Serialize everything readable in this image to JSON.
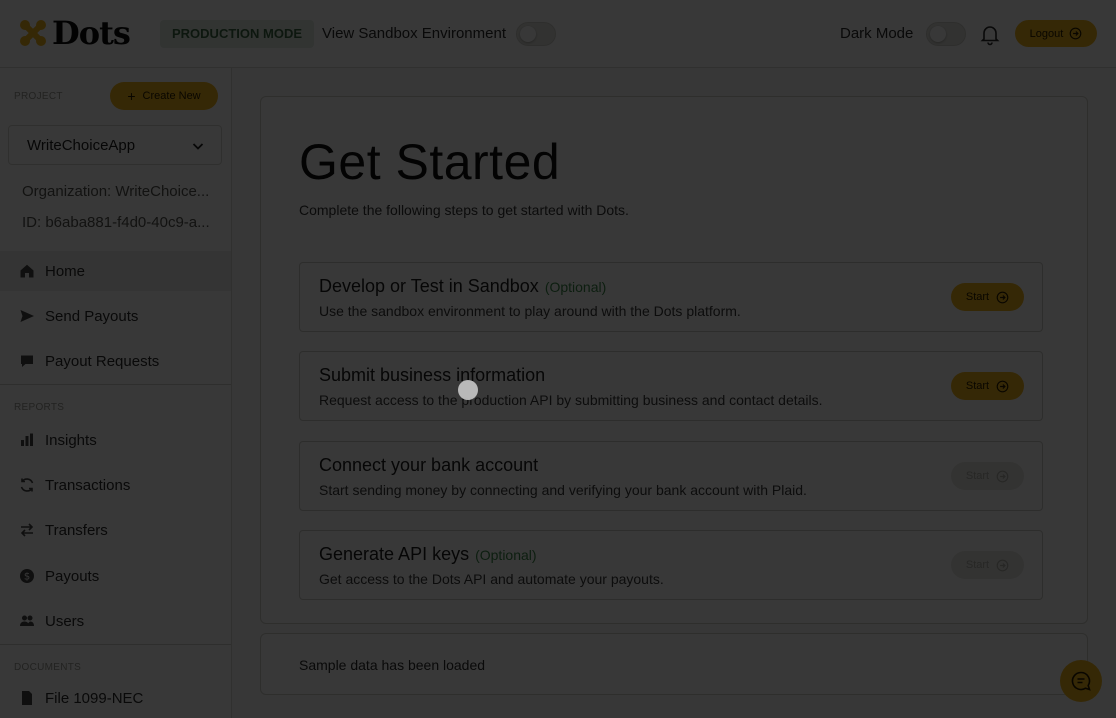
{
  "header": {
    "brand": "Dots",
    "mode_badge": "PRODUCTION MODE",
    "sandbox_label": "View Sandbox Environment",
    "dark_mode_label": "Dark Mode",
    "logout_label": "Logout",
    "sandbox_toggle_on": false,
    "dark_mode_toggle_on": false
  },
  "sidebar": {
    "project_label": "PROJECT",
    "create_new_label": "Create New",
    "selected_project": "WriteChoiceApp",
    "organization": "Organization: WriteChoice...",
    "id": "ID: b6aba881-f4d0-40c9-a...",
    "main_items": [
      {
        "label": "Home",
        "icon": "home-icon",
        "active": true
      },
      {
        "label": "Send Payouts",
        "icon": "send-icon"
      },
      {
        "label": "Payout Requests",
        "icon": "chat-icon"
      }
    ],
    "reports_label": "REPORTS",
    "report_items": [
      {
        "label": "Insights",
        "icon": "bar-chart-icon"
      },
      {
        "label": "Transactions",
        "icon": "refresh-icon"
      },
      {
        "label": "Transfers",
        "icon": "transfer-icon"
      },
      {
        "label": "Payouts",
        "icon": "dollar-icon"
      },
      {
        "label": "Users",
        "icon": "users-icon"
      }
    ],
    "documents_label": "DOCUMENTS",
    "document_items": [
      {
        "label": "File 1099-NEC",
        "icon": "file-icon"
      }
    ]
  },
  "main": {
    "title": "Get Started",
    "subtitle": "Complete the following steps to get started with Dots.",
    "steps": [
      {
        "title": "Develop or Test in Sandbox",
        "optional": "(Optional)",
        "description": "Use the sandbox environment to play around with the Dots platform.",
        "button": "Start",
        "enabled": true
      },
      {
        "title": "Submit business information",
        "optional": "",
        "description": "Request access to the production API by submitting business and contact details.",
        "button": "Start",
        "enabled": true
      },
      {
        "title": "Connect your bank account",
        "optional": "",
        "description": "Start sending money by connecting and verifying your bank account with Plaid.",
        "button": "Start",
        "enabled": false
      },
      {
        "title": "Generate API keys",
        "optional": "(Optional)",
        "description": "Get access to the Dots API and automate your payouts.",
        "button": "Start",
        "enabled": false
      }
    ],
    "notice": "Sample data has been loaded"
  },
  "colors": {
    "accent": "#f2b51d",
    "optional_green": "#3b8a4a",
    "badge_bg": "#e3eee4",
    "badge_text": "#3c6b44"
  }
}
